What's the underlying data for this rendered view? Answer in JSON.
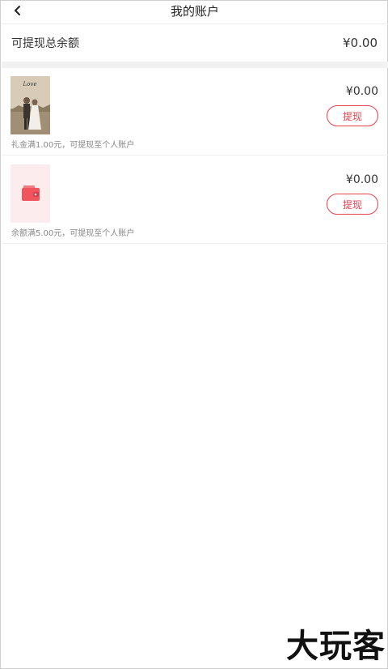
{
  "header": {
    "title": "我的账户",
    "back_icon": "chevron-left-icon"
  },
  "total": {
    "label": "可提现总余额",
    "amount": "¥0.00"
  },
  "cards": [
    {
      "amount": "¥0.00",
      "button_label": "提现",
      "note": "礼金满1.00元，可提现至个人账户",
      "thumb_caption": "Love",
      "thumb_icon": "wedding-photo"
    },
    {
      "amount": "¥0.00",
      "button_label": "提现",
      "note": "余额满5.00元，可提现至个人账户",
      "thumb_icon": "wallet-icon"
    }
  ],
  "watermark": "大玩客",
  "colors": {
    "accent": "#e8414f",
    "wallet": "#f0555f",
    "wallet_bg": "#fdeced",
    "divider": "#f2f2f2"
  }
}
